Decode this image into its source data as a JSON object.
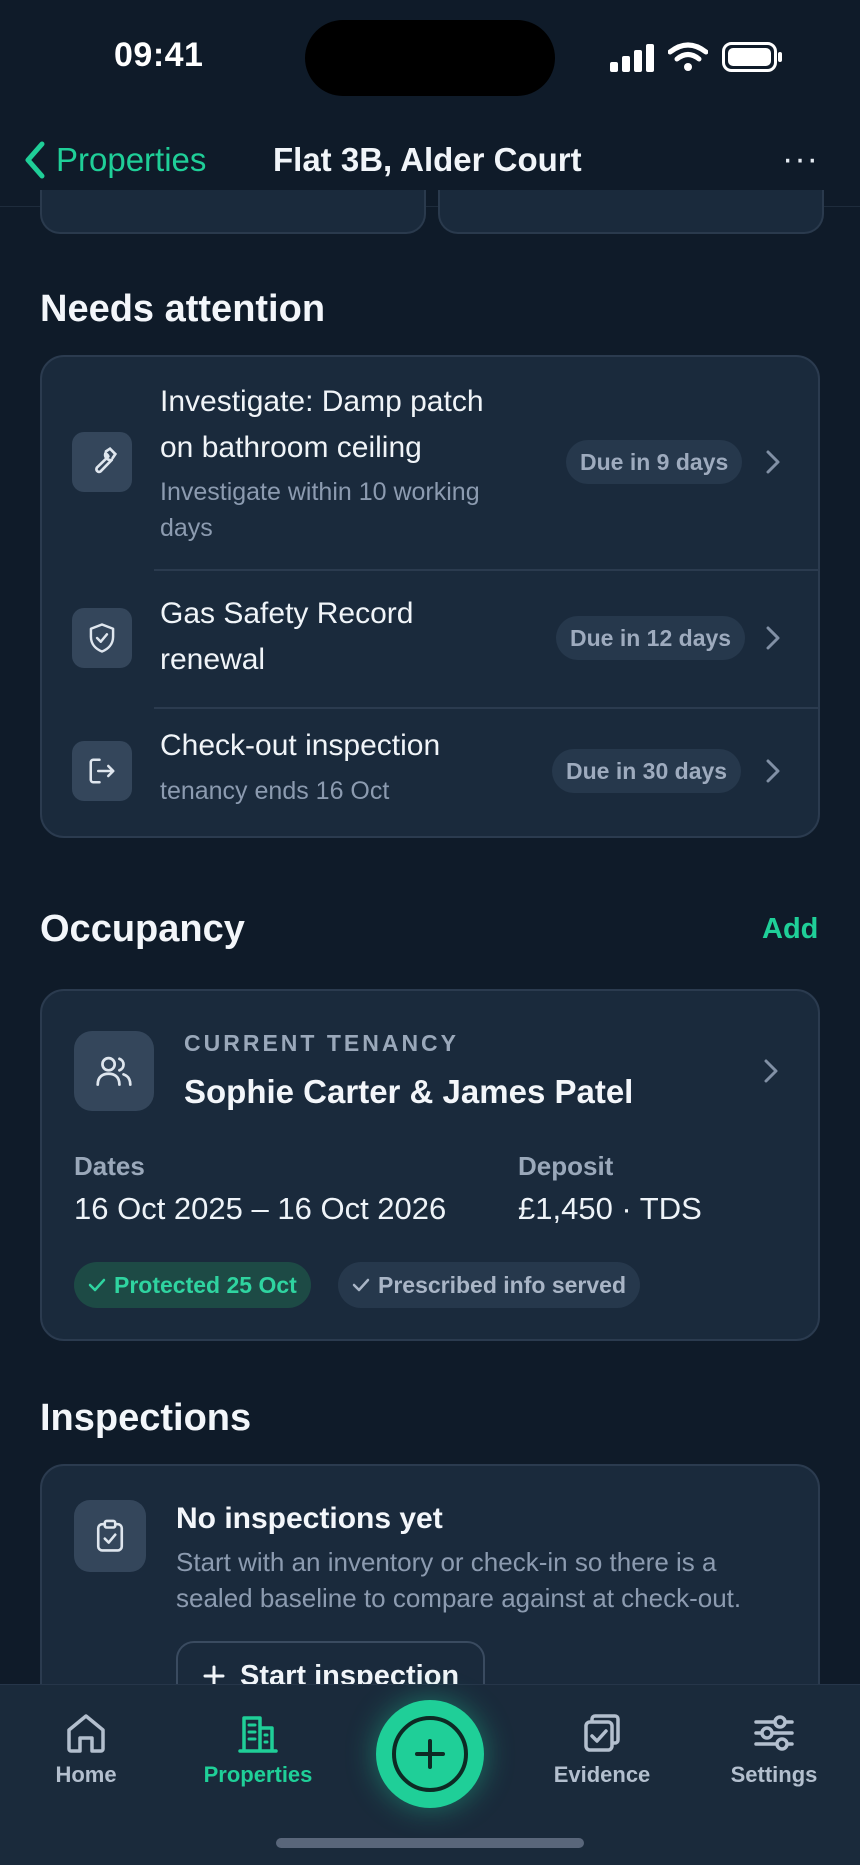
{
  "status_bar": {
    "time": "09:41"
  },
  "nav": {
    "back_label": "Properties",
    "title": "Flat 3B, Alder Court",
    "more_label": "···"
  },
  "needs_attention": {
    "title": "Needs attention",
    "items": [
      {
        "icon": "wrench-icon",
        "title_line1": "Investigate: Damp patch",
        "title_line2": "on bathroom ceiling",
        "sub_line1": "Investigate within 10 working",
        "sub_line2": "days",
        "due": "Due in 9 days"
      },
      {
        "icon": "shield-check-icon",
        "title_line1": "Gas Safety Record",
        "title_line2": "renewal",
        "due": "Due in 12 days"
      },
      {
        "icon": "exit-icon",
        "title_line1": "Check-out inspection",
        "sub_line1": "tenancy ends 16 Oct",
        "due": "Due in 30 days"
      }
    ]
  },
  "occupancy": {
    "title": "Occupancy",
    "add_label": "Add",
    "card": {
      "overline": "CURRENT TENANCY",
      "tenants": "Sophie Carter & James Patel",
      "dates_label": "Dates",
      "dates_value": "16 Oct 2025 – 16 Oct 2026",
      "deposit_label": "Deposit",
      "deposit_value": "£1,450 · TDS",
      "chip_protected": "Protected 25 Oct",
      "chip_prescribed": "Prescribed info served"
    }
  },
  "inspections": {
    "title": "Inspections",
    "empty_title": "No inspections yet",
    "empty_line1": "Start with an inventory or check-in so there is a",
    "empty_line2": "sealed baseline to compare against at check-out.",
    "button_label": "Start inspection"
  },
  "tabbar": {
    "home": "Home",
    "properties": "Properties",
    "evidence": "Evidence",
    "settings": "Settings"
  },
  "colors": {
    "accent": "#1fcf98",
    "background": "#0f1b29",
    "card": "#1a2a3c"
  }
}
